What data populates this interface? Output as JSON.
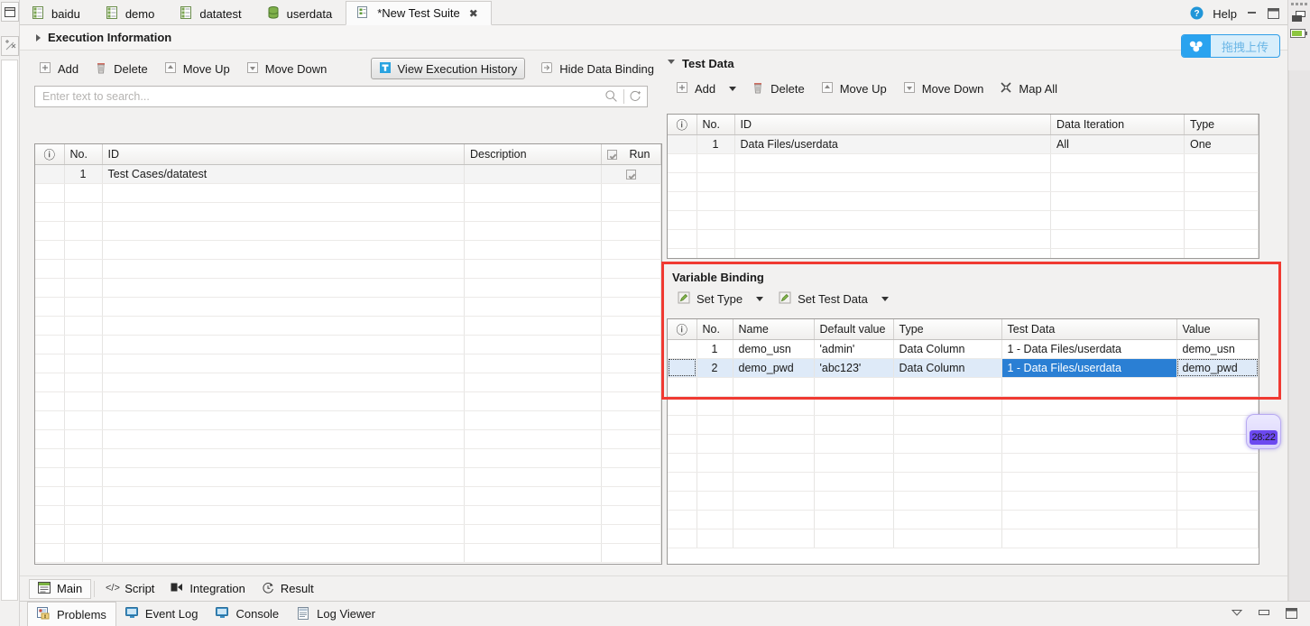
{
  "window": {
    "help_label": "Help",
    "minimize_icon": "minimize-icon",
    "maximize_icon": "maximize-icon",
    "restore_icon": "restore-icon"
  },
  "tabs": [
    {
      "label": "baidu",
      "icon": "test-case-icon",
      "active": false,
      "closable": false
    },
    {
      "label": "demo",
      "icon": "test-case-icon",
      "active": false,
      "closable": false
    },
    {
      "label": "datatest",
      "icon": "test-case-icon",
      "active": false,
      "closable": false
    },
    {
      "label": "userdata",
      "icon": "data-file-icon",
      "active": false,
      "closable": false
    },
    {
      "label": "*New Test Suite",
      "icon": "test-suite-icon",
      "active": true,
      "closable": true,
      "close_glyph": "✖"
    }
  ],
  "execution_information": {
    "title": "Execution Information",
    "expander_icon": "triangle-right-icon"
  },
  "upload_button": {
    "label": "拖拽上传",
    "icon": "baidu-cloud-icon",
    "accent": "#2aa3ef",
    "background": "#d8eefb"
  },
  "left_pane": {
    "toolbar": [
      {
        "label": "Add",
        "icon": "plus-box-icon"
      },
      {
        "label": "Delete",
        "icon": "trash-icon"
      },
      {
        "label": "Move Up",
        "icon": "arrow-up-box-icon"
      },
      {
        "label": "Move Down",
        "icon": "arrow-down-box-icon"
      },
      {
        "label": "View Execution History",
        "icon": "history-icon",
        "pressed": true
      },
      {
        "label": "Hide Data Binding",
        "icon": "arrow-right-box-icon"
      }
    ],
    "search": {
      "placeholder": "Enter text to search...",
      "search_icon": "magnifier-icon",
      "refresh_icon": "refresh-search-icon"
    },
    "table": {
      "columns": [
        "",
        "No.",
        "ID",
        "Description",
        "Run"
      ],
      "error_header_icon": "error-circle-icon",
      "run_header_checkbox": true,
      "rows": [
        {
          "no": "1",
          "id": "Test Cases/datatest",
          "description": "",
          "run_checked": true
        }
      ],
      "empty_rows": 20
    }
  },
  "right_pane": {
    "test_data": {
      "title": "Test Data",
      "expander_icon": "triangle-down-icon",
      "toolbar": [
        {
          "label": "Add",
          "icon": "plus-box-icon",
          "caret": true
        },
        {
          "label": "Delete",
          "icon": "trash-icon"
        },
        {
          "label": "Move Up",
          "icon": "arrow-up-box-icon"
        },
        {
          "label": "Move Down",
          "icon": "arrow-down-box-icon"
        },
        {
          "label": "Map All",
          "icon": "map-all-icon"
        }
      ],
      "table": {
        "columns": [
          "",
          "No.",
          "ID",
          "Data Iteration",
          "Type"
        ],
        "error_header_icon": "error-circle-icon",
        "rows": [
          {
            "no": "1",
            "id": "Data Files/userdata",
            "data_iteration": "All",
            "type": "One"
          }
        ],
        "empty_rows": 6
      }
    },
    "variable_binding": {
      "title": "Variable Binding",
      "highlighted": true,
      "highlight_color": "#f03a32",
      "toolbar": [
        {
          "label": "Set Type",
          "icon": "edit-pencil-icon",
          "caret": true
        },
        {
          "label": "Set Test Data",
          "icon": "edit-pencil-icon",
          "caret": true
        }
      ],
      "table": {
        "columns": [
          "",
          "No.",
          "Name",
          "Default value",
          "Type",
          "Test Data",
          "Value"
        ],
        "error_header_icon": "error-circle-icon",
        "rows": [
          {
            "no": "1",
            "name": "demo_usn",
            "default_value": "'admin'",
            "type": "Data Column",
            "test_data": "1 - Data Files/userdata",
            "value": "demo_usn",
            "selected": false
          },
          {
            "no": "2",
            "name": "demo_pwd",
            "default_value": "'abc123'",
            "type": "Data Column",
            "test_data": "1 - Data Files/userdata",
            "value": "demo_pwd",
            "selected": true,
            "active_cell": "test_data"
          }
        ],
        "empty_rows": 9
      }
    }
  },
  "timer_badge": {
    "value": "28:22",
    "color": "#6c49f0"
  },
  "bottom_editor_tabs": [
    {
      "label": "Main",
      "icon": "main-view-icon",
      "active": true
    },
    {
      "label": "Script",
      "icon": "code-icon",
      "active": false
    },
    {
      "label": "Integration",
      "icon": "integration-icon",
      "active": false
    },
    {
      "label": "Result",
      "icon": "result-clock-icon",
      "active": false
    }
  ],
  "bottom_views": [
    {
      "label": "Problems",
      "icon": "problems-icon",
      "active": true
    },
    {
      "label": "Event Log",
      "icon": "monitor-icon",
      "active": false
    },
    {
      "label": "Console",
      "icon": "monitor-icon",
      "active": false
    },
    {
      "label": "Log Viewer",
      "icon": "log-viewer-icon",
      "active": false
    }
  ],
  "bottom_controls": {
    "collapse_icon": "collapse-chevron-icon",
    "minimize_icon": "minimize-icon",
    "maximize_icon": "maximize-icon"
  }
}
